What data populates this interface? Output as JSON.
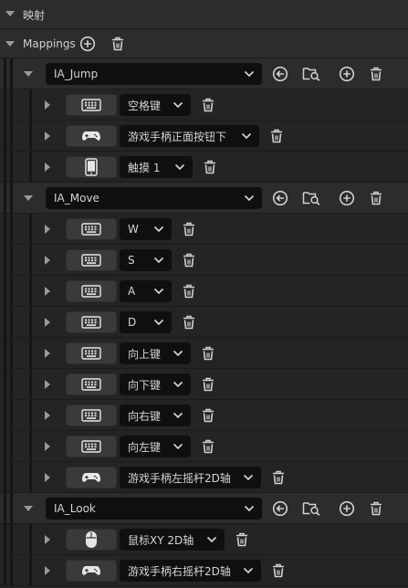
{
  "section": {
    "title": "映射"
  },
  "mappings": {
    "label": "Mappings"
  },
  "actions": [
    {
      "name": "IA_Jump",
      "bindings": [
        {
          "device": "keyboard-icon",
          "key": "空格键"
        },
        {
          "device": "gamepad-icon",
          "key": "游戏手柄正面按钮下"
        },
        {
          "device": "touch-icon",
          "key": "触摸 1"
        }
      ]
    },
    {
      "name": "IA_Move",
      "bindings": [
        {
          "device": "keyboard-icon",
          "key": "W"
        },
        {
          "device": "keyboard-icon",
          "key": "S"
        },
        {
          "device": "keyboard-icon",
          "key": "A"
        },
        {
          "device": "keyboard-icon",
          "key": "D"
        },
        {
          "device": "keyboard-icon",
          "key": "向上键"
        },
        {
          "device": "keyboard-icon",
          "key": "向下键"
        },
        {
          "device": "keyboard-icon",
          "key": "向右键"
        },
        {
          "device": "keyboard-icon",
          "key": "向左键"
        },
        {
          "device": "gamepad-icon",
          "key": "游戏手柄左摇杆2D轴"
        }
      ]
    },
    {
      "name": "IA_Look",
      "bindings": [
        {
          "device": "mouse-icon",
          "key": "鼠标XY 2D轴"
        },
        {
          "device": "gamepad-icon",
          "key": "游戏手柄右摇杆2D轴"
        }
      ]
    }
  ]
}
